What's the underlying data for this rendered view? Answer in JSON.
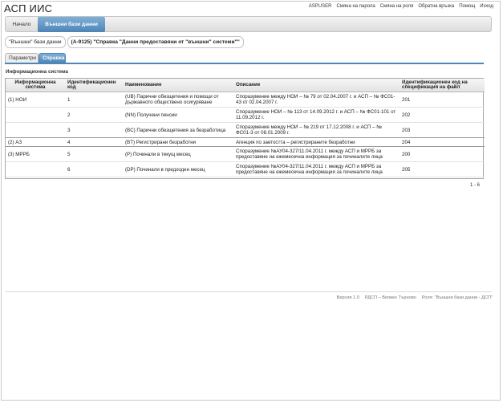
{
  "app": {
    "title": "АСП ИИС"
  },
  "top_links": [
    "ASPUSER",
    "Смяна на парола",
    "Смяна на роля",
    "Обратна връзка",
    "Помощ",
    "Изход"
  ],
  "nav": {
    "home": "Начало",
    "external": "Външни бази данни"
  },
  "breadcrumb": {
    "parent": "\"Външни\" бази данни",
    "current": "(А-9125) \"Справка \"Данни предоставяни от \"външни\" системи\"\""
  },
  "tabs": {
    "params": "Параметри",
    "reference": "Справка"
  },
  "section_label": "Информационна система",
  "table": {
    "headers": {
      "system": "Информационна система",
      "code": "Идентификационен код",
      "name": "Наименование",
      "description": "Описание",
      "spec_code": "Идентификационен код на спецификация на файл"
    },
    "rows": [
      {
        "system": "(1) НОИ",
        "code": "1",
        "name": "(UB) Парични обезщетения и помощи от държавното обществено осигуряване",
        "description": "Споразумение между НОИ – № 79 от 02.04.2007 г. и АСП – № ФС01-43 от 02.04.2007 г.",
        "spec_code": "201"
      },
      {
        "system": "",
        "code": "2",
        "name": "(NN) Получени пенсии",
        "description": "Споразумение НОИ – № 113 от 14.09.2012 г. и АСП – № ФС01-101 от 11.09.2012 г.",
        "spec_code": "202"
      },
      {
        "system": "",
        "code": "3",
        "name": "(BC) Парични обезщетения за безработица",
        "description": "Споразумение между НОИ – № 219 от 17.12.2008 г. и АСП – № ФС01-3 от 08.01.2009 г.",
        "spec_code": "203"
      },
      {
        "system": "(2) АЗ",
        "code": "4",
        "name": "(BT) Регистрирани безработни",
        "description": "Агенция по заетостта – регистрираните безработни",
        "spec_code": "204"
      },
      {
        "system": "(3) МРРБ",
        "code": "5",
        "name": "(P) Починали в текущ месец",
        "description": "Споразумение №АУ04-327/11.04.2011 г. между АСП и МРРБ за предоставяне на ежемесечна информация за починалите лица",
        "spec_code": "200"
      },
      {
        "system": "",
        "code": "6",
        "name": "(DP) Починали в предходен месец",
        "description": "Споразумение №АУ04-327/11.04.2011 г. между АСП и МРРБ за предоставяне на ежемесечна информация за починалите лица",
        "spec_code": "205"
      }
    ]
  },
  "pager": "1 - 6",
  "footer": {
    "version": "Версия 1.0",
    "office": "РДСП – Велико Търново",
    "role": "Роля: \"Външни бази данни - ДСП\""
  }
}
